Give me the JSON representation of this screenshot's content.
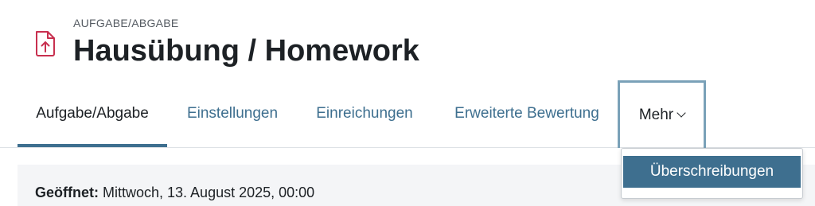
{
  "header": {
    "pre_title": "AUFGABE/ABGABE",
    "title": "Hausübung / Homework",
    "icon": "assignment-upload-icon",
    "icon_color": "#c8304f"
  },
  "tabs": [
    {
      "label": "Aufgabe/Abgabe",
      "active": true
    },
    {
      "label": "Einstellungen"
    },
    {
      "label": "Einreichungen"
    },
    {
      "label": "Erweiterte Bewertung"
    }
  ],
  "more_tab": {
    "label": "Mehr",
    "icon": "chevron-down-icon"
  },
  "dropdown": {
    "items": [
      "Überschreibungen"
    ]
  },
  "dates": {
    "opened_label": "Geöffnet:",
    "opened_value": " Mittwoch, 13. August 2025, 00:00"
  },
  "colors": {
    "accent": "#3e6f8f",
    "focus_border": "#7aa1b8",
    "icon": "#c8304f"
  }
}
